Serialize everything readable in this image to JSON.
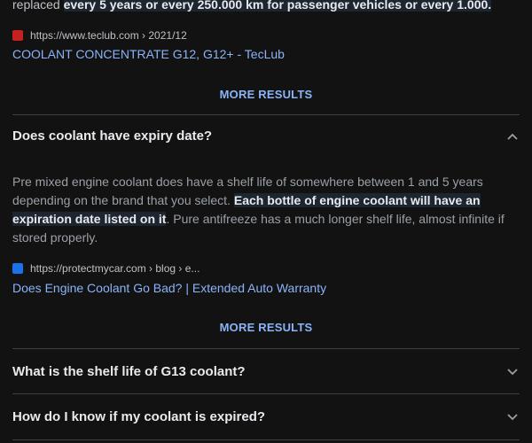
{
  "top_snippet": {
    "prefix": "replaced ",
    "highlight": "every 5 years or every 250.000 km for passenger vehicles or every 1.000."
  },
  "result1": {
    "source": "https://www.teclub.com › 2021/12",
    "title": "COOLANT CONCENTRATE G12, G12+ - TecLub",
    "favicon_color": "#c5221f"
  },
  "more1": {
    "label": "MORE RESULTS"
  },
  "q1": {
    "question": "Does coolant have expiry date?",
    "expanded": true,
    "answer_part1": "Pre mixed engine coolant does have a shelf life of somewhere between 1 and 5 years depending on the brand that you select. ",
    "answer_highlight": "Each bottle of engine coolant will have an expiration date listed on it",
    "answer_part2": ". Pure antifreeze has a much longer shelf life, almost infinite if stored properly."
  },
  "result2": {
    "source": "https://protectmycar.com › blog › e...",
    "title": "Does Engine Coolant Go Bad? | Extended Auto Warranty",
    "favicon_color": "#1a73e8"
  },
  "more2": {
    "label": "MORE RESULTS"
  },
  "q2": {
    "question": "What is the shelf life of G13 coolant?",
    "expanded": false
  },
  "q3": {
    "question": "How do I know if my coolant is expired?",
    "expanded": false
  },
  "colors": {
    "link": "#8ab4f8",
    "background": "#121212",
    "divider": "#3c4043"
  }
}
